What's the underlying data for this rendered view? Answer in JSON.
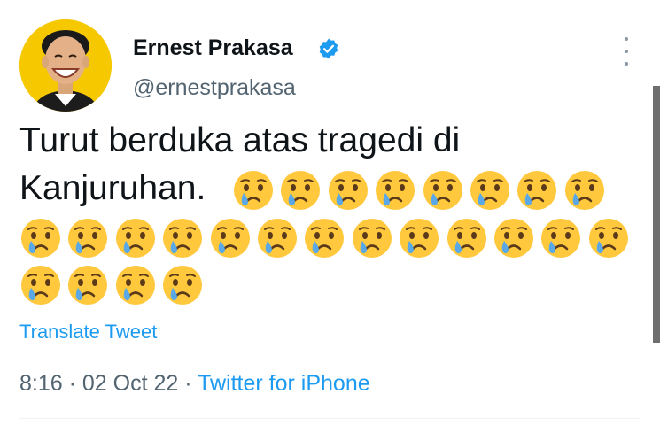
{
  "author": {
    "display_name": "Ernest Prakasa",
    "handle": "@ernestprakasa",
    "verified": true
  },
  "tweet": {
    "text_line1": "Turut berduka atas tragedi di",
    "text_line2": "Kanjuruhan.",
    "emoji": "crying-face",
    "emoji_count": 25,
    "translate_label": "Translate Tweet",
    "time": "8:16",
    "date": "02 Oct 22",
    "separator": "·",
    "source": "Twitter for iPhone"
  },
  "colors": {
    "accent": "#1d9bf0",
    "secondary_text": "#536471",
    "avatar_bg": "#f5c800",
    "emoji_face": "#ffc83d",
    "emoji_tear": "#5aa9e6"
  }
}
